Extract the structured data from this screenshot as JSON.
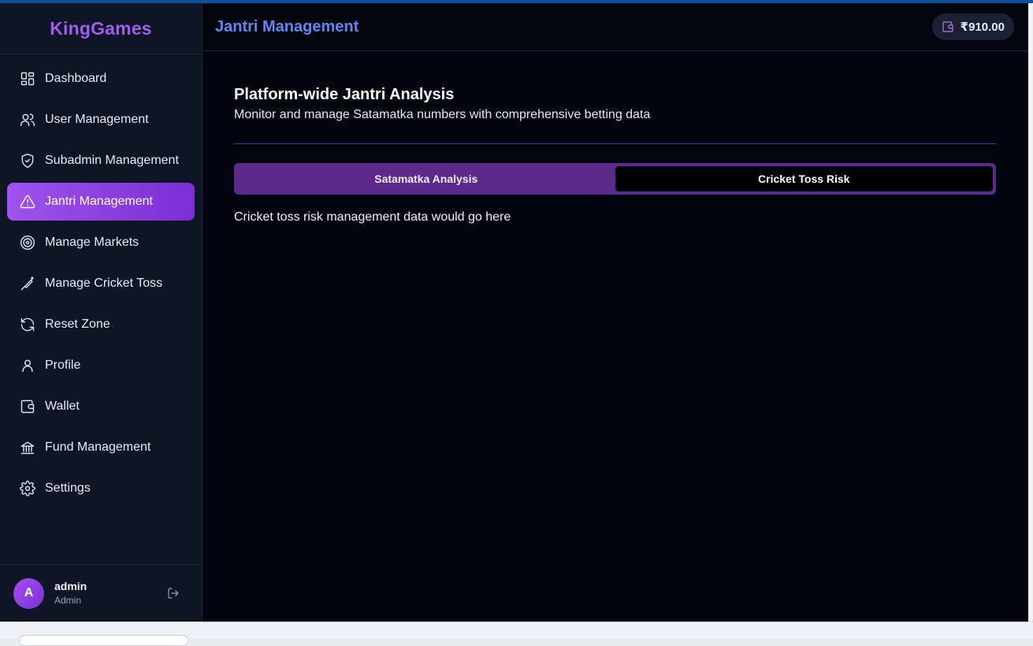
{
  "brand": {
    "name": "KingGames"
  },
  "header": {
    "title": "Jantri Management",
    "balance": "₹910.00"
  },
  "sidebar": {
    "items": [
      {
        "label": "Dashboard",
        "icon": "dashboard-icon",
        "active": false
      },
      {
        "label": "User Management",
        "icon": "users-icon",
        "active": false
      },
      {
        "label": "Subadmin Management",
        "icon": "shield-check-icon",
        "active": false
      },
      {
        "label": "Jantri Management",
        "icon": "warning-triangle-icon",
        "active": true
      },
      {
        "label": "Manage Markets",
        "icon": "target-icon",
        "active": false
      },
      {
        "label": "Manage Cricket Toss",
        "icon": "cricket-bat-icon",
        "active": false
      },
      {
        "label": "Reset Zone",
        "icon": "refresh-icon",
        "active": false
      },
      {
        "label": "Profile",
        "icon": "user-icon",
        "active": false
      },
      {
        "label": "Wallet",
        "icon": "wallet-icon",
        "active": false
      },
      {
        "label": "Fund Management",
        "icon": "bank-icon",
        "active": false
      },
      {
        "label": "Settings",
        "icon": "gear-icon",
        "active": false
      }
    ]
  },
  "user": {
    "initial": "A",
    "name": "admin",
    "role": "Admin"
  },
  "page": {
    "title": "Platform-wide Jantri Analysis",
    "subtitle": "Monitor and manage Satamatka numbers with comprehensive betting data",
    "tabs": [
      {
        "label": "Satamatka Analysis",
        "active": false
      },
      {
        "label": "Cricket Toss Risk",
        "active": true
      }
    ],
    "tab_content": "Cricket toss risk management data would go here"
  },
  "colors": {
    "accent": "#a052ec",
    "header_title": "#5f86f0",
    "background": "#03040f",
    "sidebar": "#0e1525"
  }
}
